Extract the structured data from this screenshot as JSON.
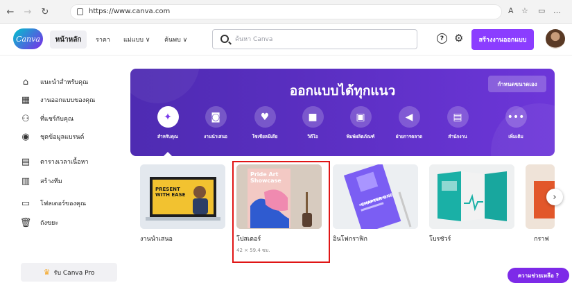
{
  "browser": {
    "url": "https://www.canva.com",
    "back_icon": "back-arrow-icon",
    "reload_icon": "reload-icon"
  },
  "header": {
    "logo_text": "Canva",
    "nav": [
      "หน้าหลัก",
      "ราคา",
      "แม่แบบ ∨",
      "ค้นพบ ∨"
    ],
    "search_placeholder": "ค้นหา Canva",
    "help_glyph": "?",
    "create_button": "สร้างงานออกแบบ"
  },
  "sidebar": {
    "items": [
      {
        "label": "แนะนำสำหรับคุณ",
        "icon": "home-icon"
      },
      {
        "label": "งานออกแบบของคุณ",
        "icon": "grid-icon"
      },
      {
        "label": "ที่แชร์กับคุณ",
        "icon": "shared-users-icon"
      },
      {
        "label": "ชุดข้อมูลแบรนด์",
        "icon": "brand-kit-icon"
      },
      {
        "label": "ตารางเวลาเนื้อหา",
        "icon": "calendar-icon"
      },
      {
        "label": "สร้างทีม",
        "icon": "team-icon"
      },
      {
        "label": "โฟลเดอร์ของคุณ",
        "icon": "folder-icon"
      },
      {
        "label": "ถังขยะ",
        "icon": "trash-icon"
      }
    ],
    "pro_button": "รับ Canva Pro"
  },
  "hero": {
    "title": "ออกแบบได้ทุกแนว",
    "custom_size_button": "กำหนดขนาดเอง",
    "categories": [
      {
        "label": "สำหรับคุณ",
        "icon": "sparkle-icon",
        "glyph": "✦"
      },
      {
        "label": "งานนำเสนอ",
        "icon": "presentation-icon",
        "glyph": "◙"
      },
      {
        "label": "โซเชียลมีเดีย",
        "icon": "heart-chat-icon",
        "glyph": "♥"
      },
      {
        "label": "วิดีโอ",
        "icon": "video-icon",
        "glyph": "■"
      },
      {
        "label": "พิมพ์ผลิตภัณฑ์",
        "icon": "print-icon",
        "glyph": "▣"
      },
      {
        "label": "ฝ่ายการตลาด",
        "icon": "megaphone-icon",
        "glyph": "◀"
      },
      {
        "label": "สำนักงาน",
        "icon": "briefcase-icon",
        "glyph": "▤"
      },
      {
        "label": "เพิ่มเติม",
        "icon": "more-dots-icon",
        "glyph": "•••"
      }
    ]
  },
  "cards": [
    {
      "label": "งานนำเสนอ",
      "image_text": "PRESENT WITH EASE",
      "sub": ""
    },
    {
      "label": "โปสเตอร์",
      "image_text": "Pride Art Showcase",
      "sub": "42 × 59.4 ซม."
    },
    {
      "label": "อินโฟกราฟิก",
      "image_text": "CHAPTER ONE",
      "sub": ""
    },
    {
      "label": "โบรชัวร์",
      "image_text": "",
      "sub": ""
    },
    {
      "label": "กราฟ",
      "image_text": "",
      "sub": ""
    }
  ],
  "help_button": "ความช่วยเหลือ ?",
  "colors": {
    "accent": "#8b3dff",
    "hero_start": "#4e2bb2",
    "hero_end": "#6d36d9",
    "selection": "#e01515"
  }
}
